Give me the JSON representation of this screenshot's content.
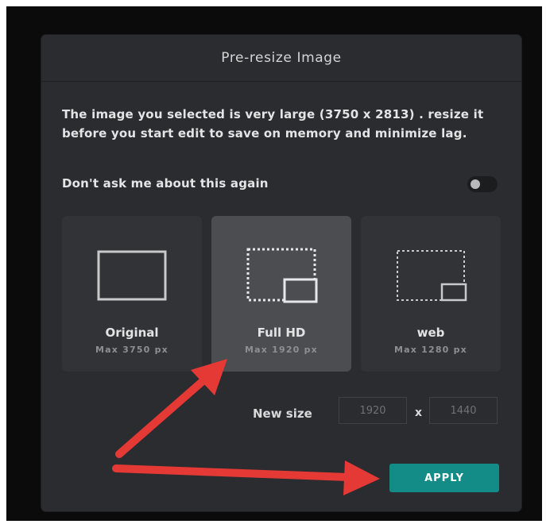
{
  "dialog": {
    "title": "Pre-resize Image",
    "message": "The image you selected is very large (3750 x 2813) . resize it before you start edit to save on memory and minimize lag.",
    "dont_ask_label": "Don't ask me about this again",
    "dont_ask_enabled": false
  },
  "options": [
    {
      "label": "Original",
      "sub": "Max 3750 px",
      "selected": false,
      "icon": "original-size-icon"
    },
    {
      "label": "Full HD",
      "sub": "Max 1920 px",
      "selected": true,
      "icon": "full-hd-size-icon"
    },
    {
      "label": "web",
      "sub": "Max 1280 px",
      "selected": false,
      "icon": "web-size-icon"
    }
  ],
  "new_size": {
    "label": "New size",
    "width": "1920",
    "height": "1440",
    "separator": "x"
  },
  "apply_label": "APPLY",
  "colors": {
    "accent": "#138b86",
    "dialog_bg": "#2b2c2f",
    "annotation_arrow": "#e53935"
  }
}
